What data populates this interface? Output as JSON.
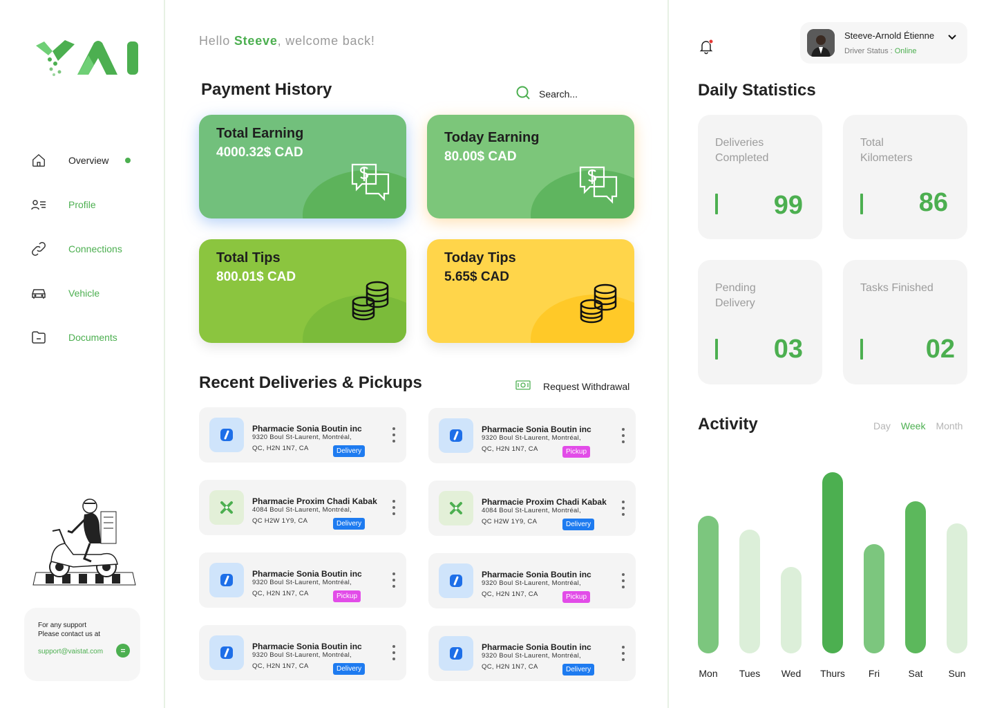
{
  "sidebar": {
    "nav": [
      {
        "label": "Overview",
        "icon": "home-icon",
        "active": true
      },
      {
        "label": "Profile",
        "icon": "profile-icon",
        "active": false
      },
      {
        "label": "Connections",
        "icon": "link-icon",
        "active": false
      },
      {
        "label": "Vehicle",
        "icon": "car-icon",
        "active": false
      },
      {
        "label": "Documents",
        "icon": "folder-icon",
        "active": false
      }
    ],
    "support": {
      "line1": "For any support",
      "line2": "Please contact us at",
      "email": "support@vaistat.com"
    }
  },
  "main": {
    "greeting": {
      "prefix": "Hello ",
      "name": "Steeve",
      "suffix": ", welcome back!"
    },
    "payment_title": "Payment History",
    "search_placeholder": "Search...",
    "payment_cards": [
      {
        "title": "Total Earning",
        "value": "4000.32$ CAD"
      },
      {
        "title": "Today Earning",
        "value": "80.00$ CAD"
      },
      {
        "title": "Total Tips",
        "value": "800.01$ CAD"
      },
      {
        "title": "Today Tips",
        "value": "5.65$ CAD"
      }
    ],
    "recent_title": "Recent Deliveries & Pickups",
    "withdraw_label": "Request Withdrawal",
    "deliveries": [
      {
        "name": "Pharmacie Sonia Boutin inc",
        "addr1": "9320 Boul St-Laurent, Montréal,",
        "addr2": "QC, H2N 1N7, CA",
        "type": "Delivery"
      },
      {
        "name": "Pharmacie Sonia Boutin inc",
        "addr1": "9320 Boul St-Laurent, Montréal,",
        "addr2": "QC, H2N 1N7, CA",
        "type": "Pickup"
      },
      {
        "name": "Pharmacie Proxim Chadi Kabak",
        "addr1": "4084 Boul St-Laurent, Montréal,",
        "addr2": "QC H2W 1Y9, CA",
        "type": "Delivery"
      },
      {
        "name": "Pharmacie Proxim Chadi Kabak",
        "addr1": "4084 Boul St-Laurent, Montréal,",
        "addr2": "QC H2W 1Y9, CA",
        "type": "Delivery"
      },
      {
        "name": "Pharmacie Sonia Boutin inc",
        "addr1": "9320 Boul St-Laurent, Montréal,",
        "addr2": "QC, H2N 1N7, CA",
        "type": "Pickup"
      },
      {
        "name": "Pharmacie Sonia Boutin inc",
        "addr1": "9320 Boul St-Laurent, Montréal,",
        "addr2": "QC, H2N 1N7, CA",
        "type": "Pickup"
      },
      {
        "name": "Pharmacie Sonia Boutin inc",
        "addr1": "9320 Boul St-Laurent, Montréal,",
        "addr2": "QC, H2N 1N7, CA",
        "type": "Delivery"
      },
      {
        "name": "Pharmacie Sonia Boutin inc",
        "addr1": "9320 Boul St-Laurent, Montréal,",
        "addr2": "QC, H2N 1N7, CA",
        "type": "Delivery"
      }
    ]
  },
  "header": {
    "user_name": "Steeve-Arnold Étienne",
    "status_label": "Driver Status : ",
    "status_value": "Online"
  },
  "stats": {
    "title": "Daily Statistics",
    "cards": [
      {
        "label": "Deliveries Completed",
        "value": "99"
      },
      {
        "label": "Total Kilometers",
        "value": "86"
      },
      {
        "label": "Pending Delivery",
        "value": "03"
      },
      {
        "label": "Tasks Finished",
        "value": "02"
      }
    ]
  },
  "activity": {
    "title": "Activity",
    "tabs": [
      {
        "label": "Day",
        "active": false
      },
      {
        "label": "Week",
        "active": true
      },
      {
        "label": "Month",
        "active": false
      }
    ]
  },
  "chart_data": {
    "type": "bar",
    "categories": [
      "Mon",
      "Tues",
      "Wed",
      "Thurs",
      "Fri",
      "Sat",
      "Sun"
    ],
    "values": [
      210,
      188,
      132,
      276,
      166,
      232,
      198
    ],
    "colors": [
      "#7cc67e",
      "#dcefd9",
      "#dcefd9",
      "#4caf50",
      "#7cc67e",
      "#5cb85c",
      "#dcefd9"
    ],
    "ylim": [
      0,
      300
    ]
  },
  "colors": {
    "accent": "#4caf50",
    "delivery_tag": "#1e7bf0",
    "pickup_tag": "#e24ce8"
  }
}
